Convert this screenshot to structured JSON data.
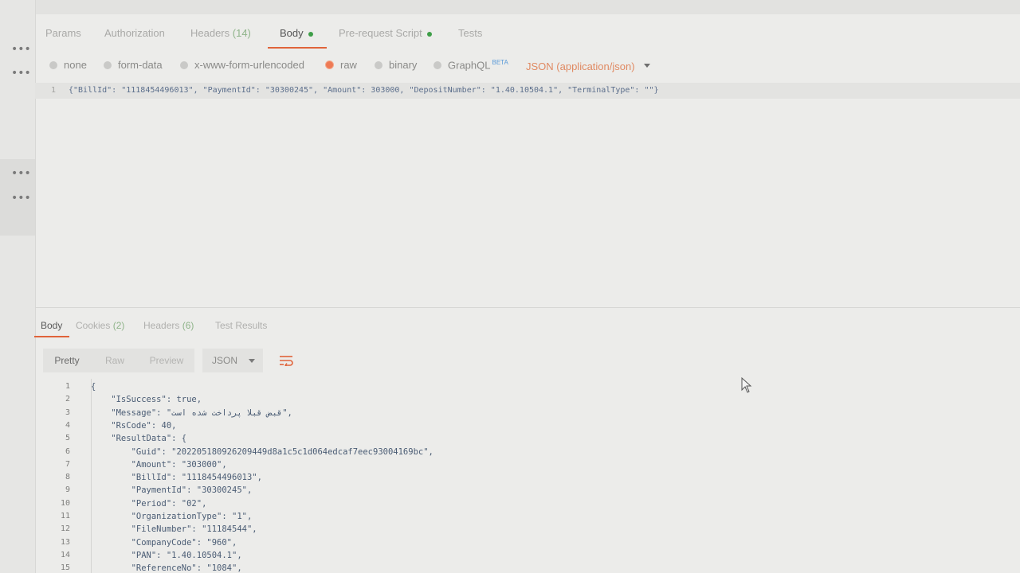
{
  "request": {
    "tabs": [
      {
        "label": "Params"
      },
      {
        "label": "Authorization"
      },
      {
        "label": "Headers",
        "count": "(14)"
      },
      {
        "label": "Body"
      },
      {
        "label": "Pre-request Script"
      },
      {
        "label": "Tests"
      }
    ],
    "active_tab": "Body",
    "body_types": [
      "none",
      "form-data",
      "x-www-form-urlencoded",
      "raw",
      "binary",
      "GraphQL"
    ],
    "selected_body_type": "raw",
    "beta_label": "BETA",
    "content_type": "JSON (application/json)",
    "editor_lines": [
      {
        "num": "1",
        "text": "{\"BillId\": \"1118454496013\", \"PaymentId\": \"30300245\", \"Amount\": 303000, \"DepositNumber\": \"1.40.10504.1\", \"TerminalType\": \"\"}"
      }
    ]
  },
  "response": {
    "tabs": [
      {
        "label": "Body"
      },
      {
        "label": "Cookies",
        "count": "(2)"
      },
      {
        "label": "Headers",
        "count": "(6)"
      },
      {
        "label": "Test Results"
      }
    ],
    "active_tab": "Body",
    "view_modes": [
      "Pretty",
      "Raw",
      "Preview"
    ],
    "active_view_mode": "Pretty",
    "format": "JSON",
    "lines": [
      {
        "num": "1",
        "text": "{"
      },
      {
        "num": "2",
        "text": "    \"IsSuccess\": true,"
      },
      {
        "num": "3",
        "text": "    \"Message\": \"قبض قبلا پرداخت شده است\","
      },
      {
        "num": "4",
        "text": "    \"RsCode\": 40,"
      },
      {
        "num": "5",
        "text": "    \"ResultData\": {"
      },
      {
        "num": "6",
        "text": "        \"Guid\": \"202205180926209449d8a1c5c1d064edcaf7eec93004169bc\","
      },
      {
        "num": "7",
        "text": "        \"Amount\": \"303000\","
      },
      {
        "num": "8",
        "text": "        \"BillId\": \"1118454496013\","
      },
      {
        "num": "9",
        "text": "        \"PaymentId\": \"30300245\","
      },
      {
        "num": "10",
        "text": "        \"Period\": \"02\","
      },
      {
        "num": "11",
        "text": "        \"OrganizationType\": \"1\","
      },
      {
        "num": "12",
        "text": "        \"FileNumber\": \"11184544\","
      },
      {
        "num": "13",
        "text": "        \"CompanyCode\": \"960\","
      },
      {
        "num": "14",
        "text": "        \"PAN\": \"1.40.10504.1\","
      },
      {
        "num": "15",
        "text": "        \"ReferenceNo\": \"1084\","
      }
    ]
  },
  "colors": {
    "accent": "#e0633a",
    "status_green": "#3e9e48",
    "count_green": "#8fb48a",
    "code_blue": "#4a5c74"
  },
  "icons": [
    "more-horizontal-icon",
    "wrap-lines-icon",
    "caret-down-icon",
    "mouse-pointer-icon"
  ]
}
